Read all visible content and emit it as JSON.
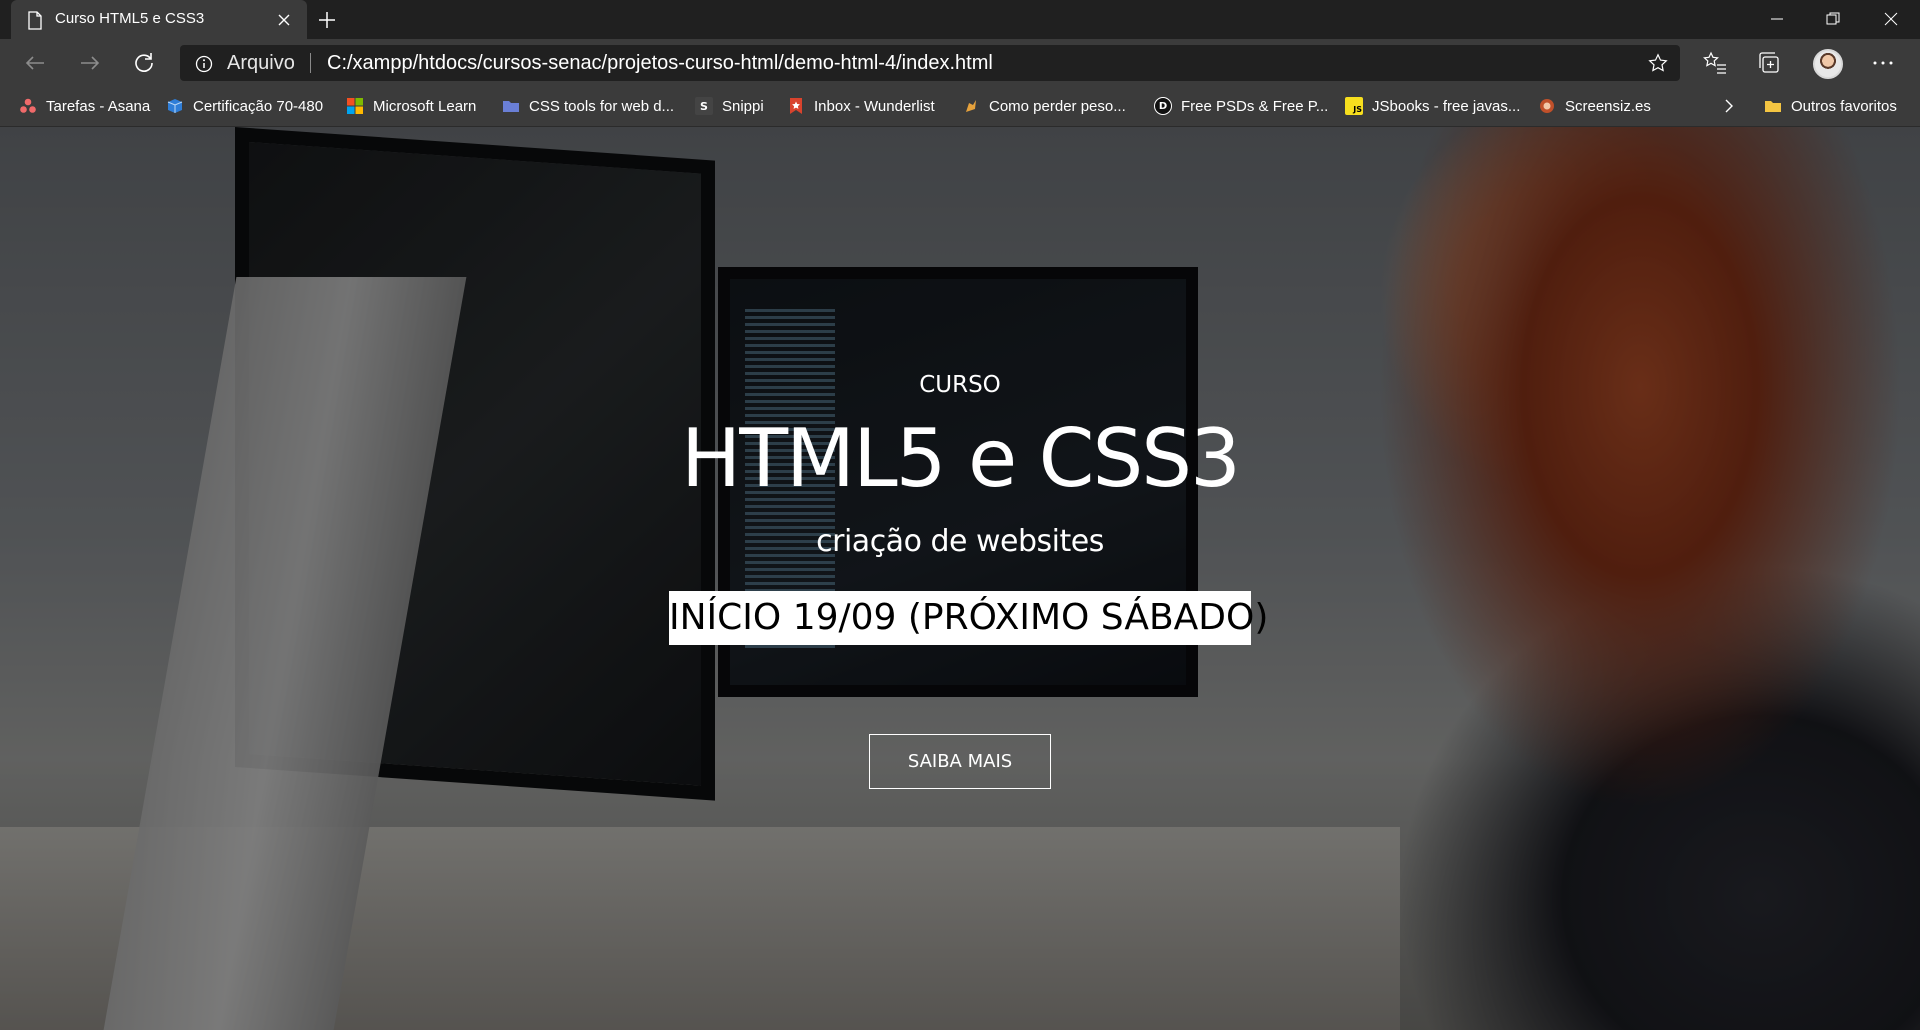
{
  "browser": {
    "tab_title": "Curso HTML5 e CSS3",
    "address_scheme": "Arquivo",
    "address_url": "C:/xampp/htdocs/cursos-senac/projetos-curso-html/demo-html-4/index.html"
  },
  "bookmarks": [
    {
      "label": "Tarefas - Asana",
      "icon": "asana-icon",
      "color": "#f06a6a"
    },
    {
      "label": "Certificação 70-480",
      "icon": "certification-icon",
      "color": "#2f7ed8"
    },
    {
      "label": "Microsoft Learn",
      "icon": "microsoft-icon",
      "color": "#f25022"
    },
    {
      "label": "CSS tools for web d...",
      "icon": "folder-blue-icon",
      "color": "#6a7fd6"
    },
    {
      "label": "Snippi",
      "icon": "snippi-icon",
      "color": "#444444",
      "glyph": "S"
    },
    {
      "label": "Inbox - Wunderlist",
      "icon": "wunderlist-icon",
      "color": "#d9432d"
    },
    {
      "label": "Como perder peso...",
      "icon": "weight-icon",
      "color": "#e6a23c"
    },
    {
      "label": "Free PSDs & Free P...",
      "icon": "dribbble-icon",
      "color": "#111111",
      "glyph": "D"
    },
    {
      "label": "JSbooks - free javas...",
      "icon": "js-icon",
      "color": "#f7df1e",
      "glyph": "JS"
    },
    {
      "label": "Screensiz.es",
      "icon": "screensizes-icon",
      "color": "#c0502a"
    }
  ],
  "other_favorites": "Outros favoritos",
  "hero": {
    "eyebrow": "CURSO",
    "title": "HTML5 e CSS3",
    "subtitle": "criação de websites",
    "date_badge": "INÍCIO 19/09 (PRÓXIMO SÁBADO)",
    "cta_label": "SAIBA MAIS"
  }
}
